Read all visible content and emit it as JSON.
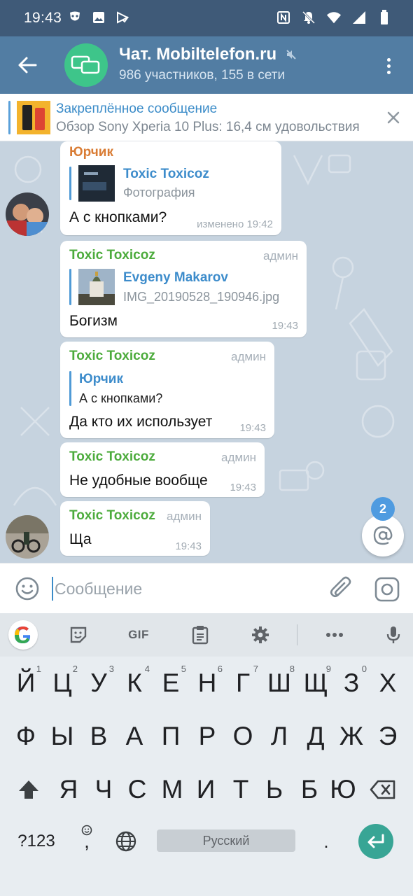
{
  "status_bar": {
    "time": "19:43",
    "icons_left": [
      "mask-icon",
      "image-icon",
      "play-check-icon"
    ],
    "icons_right": [
      "nfc-icon",
      "bell-off-icon",
      "wifi-icon",
      "signal-icon",
      "battery-icon"
    ]
  },
  "header": {
    "title": "Чат. Mobiltelefon.ru",
    "subtitle": "986 участников, 155 в сети",
    "muted": true,
    "colors": {
      "header_bg": "#527da3",
      "avatar_bg": "#3ec58a"
    }
  },
  "pinned": {
    "title": "Закреплённое сообщение",
    "text": "Обзор Sony Xperia 10 Plus: 16,4 см удовольствия"
  },
  "messages": [
    {
      "sender": "Юрчик",
      "sender_color": "#d97c34",
      "reply_name": "Toxic Toxicoz",
      "reply_text": "Фотография",
      "text": "А с кнопками?",
      "time": "изменено 19:42"
    },
    {
      "sender": "Toxic Toxicoz",
      "sender_color": "#4cab3c",
      "role": "админ",
      "reply_name": "Evgeny Makarov",
      "reply_text": "IMG_20190528_190946.jpg",
      "text": "Богизм",
      "time": "19:43"
    },
    {
      "sender": "Toxic Toxicoz",
      "sender_color": "#4cab3c",
      "role": "админ",
      "reply_name": "Юрчик",
      "reply_text": "А с кнопками?",
      "text": "Да кто их использует",
      "time": "19:43"
    },
    {
      "sender": "Toxic Toxicoz",
      "sender_color": "#4cab3c",
      "role": "админ",
      "text": "Не удобные вообще",
      "time": "19:43"
    },
    {
      "sender": "Toxic Toxicoz",
      "sender_color": "#4cab3c",
      "role": "админ",
      "text": "Ща",
      "time": "19:43"
    }
  ],
  "mentions": {
    "count": "2"
  },
  "composer": {
    "placeholder": "Сообщение"
  },
  "keyboard": {
    "toolbar": [
      "google-icon",
      "sticker-icon",
      "GIF",
      "clipboard-icon",
      "settings-icon",
      "more-icon",
      "mic-icon"
    ],
    "gif_label": "GIF",
    "row1": [
      "Й",
      "Ц",
      "У",
      "К",
      "Е",
      "Н",
      "Г",
      "Ш",
      "Щ",
      "З",
      "Х"
    ],
    "row1_nums": [
      "1",
      "2",
      "3",
      "4",
      "5",
      "6",
      "7",
      "8",
      "9",
      "0"
    ],
    "row2": [
      "Ф",
      "Ы",
      "В",
      "А",
      "П",
      "Р",
      "О",
      "Л",
      "Д",
      "Ж",
      "Э"
    ],
    "row3": [
      "Я",
      "Ч",
      "С",
      "М",
      "И",
      "Т",
      "Ь",
      "Б",
      "Ю"
    ],
    "symbols_label": "?123",
    "comma": ",",
    "space_label": "Русский",
    "period": ".",
    "colors": {
      "enter_bg": "#38a595"
    }
  }
}
